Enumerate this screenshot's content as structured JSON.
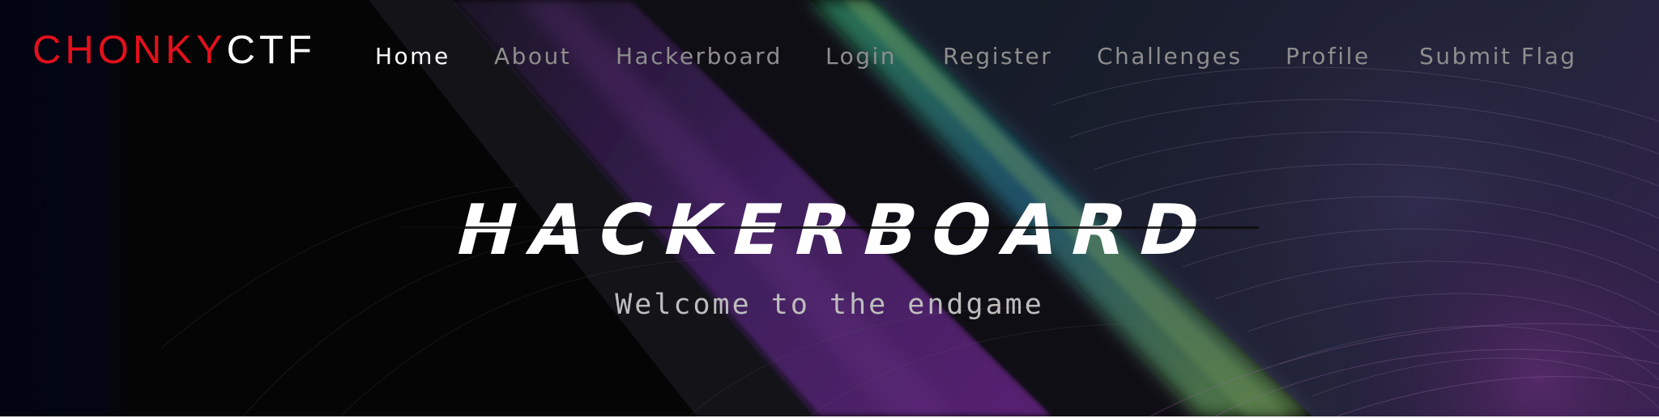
{
  "brand": {
    "part1": "CHONKY",
    "part2": "CTF"
  },
  "nav": {
    "items": [
      {
        "label": "Home",
        "active": true
      },
      {
        "label": "About",
        "active": false
      },
      {
        "label": "Hackerboard",
        "active": false
      },
      {
        "label": "Login",
        "active": false
      },
      {
        "label": "Register",
        "active": false
      },
      {
        "label": "Challenges",
        "active": false
      },
      {
        "label": "Profile",
        "active": false
      },
      {
        "label": "Submit Flag",
        "active": false
      }
    ]
  },
  "hero": {
    "title": "HACKERBOARD",
    "subtitle": "Welcome to the endgame"
  },
  "colors": {
    "brand_red": "#e3101c",
    "nav_inactive": "#8e8e8e",
    "nav_active": "#ffffff",
    "background": "#060606"
  }
}
